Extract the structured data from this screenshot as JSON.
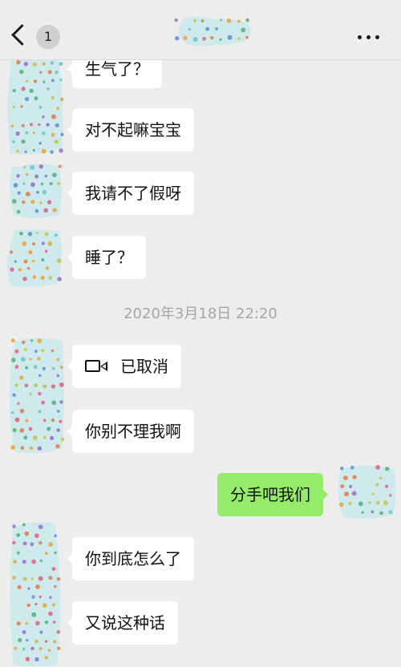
{
  "header": {
    "back_badge": "1",
    "title_blurred": true
  },
  "colors": {
    "background": "#ededed",
    "incoming_bubble": "#ffffff",
    "outgoing_bubble": "#95ec69",
    "timestamp_text": "#a6a6a6",
    "avatar_base": "#cfeaec"
  },
  "messages": [
    {
      "side": "in",
      "text": "生气了？"
    },
    {
      "side": "in",
      "text": "对不起嘛宝宝"
    },
    {
      "side": "in",
      "text": "我请不了假呀"
    },
    {
      "side": "in",
      "text": "睡了？"
    },
    {
      "side": "in",
      "text": "已取消",
      "icon": "video-call-icon"
    },
    {
      "side": "in",
      "text": "你别不理我啊"
    },
    {
      "side": "out",
      "text": "分手吧我们"
    },
    {
      "side": "in",
      "text": "你到底怎么了"
    },
    {
      "side": "in",
      "text": "又说这种话"
    }
  ],
  "timestamp": "2020年3月18日 22:20"
}
